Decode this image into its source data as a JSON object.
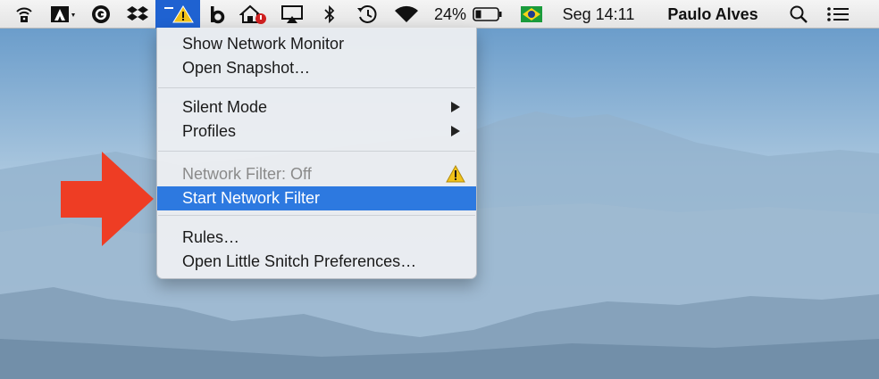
{
  "menubar": {
    "battery_percent": "24%",
    "clock": "Seg 14:11",
    "user_name": "Paulo Alves",
    "icons": [
      "wifi-lock-icon",
      "adobe-icon",
      "circle-g-icon",
      "dropbox-icon",
      "little-snitch-warning-icon",
      "b-icon",
      "home-cloud-icon",
      "airplay-icon",
      "bluetooth-icon",
      "time-machine-icon",
      "wifi-icon",
      "battery-icon",
      "brazil-flag-icon",
      "search-icon",
      "notification-center-icon"
    ]
  },
  "menu": {
    "show_network_monitor": "Show Network Monitor",
    "open_snapshot": "Open Snapshot…",
    "silent_mode": "Silent Mode",
    "profiles": "Profiles",
    "network_filter_status": "Network Filter: Off",
    "start_network_filter": "Start Network Filter",
    "rules": "Rules…",
    "open_preferences": "Open Little Snitch Preferences…"
  },
  "colors": {
    "highlight": "#2d79e0",
    "arrow": "#ee3d24",
    "warning": "#f2c218",
    "active_icon_bg": "#1f62d1"
  }
}
